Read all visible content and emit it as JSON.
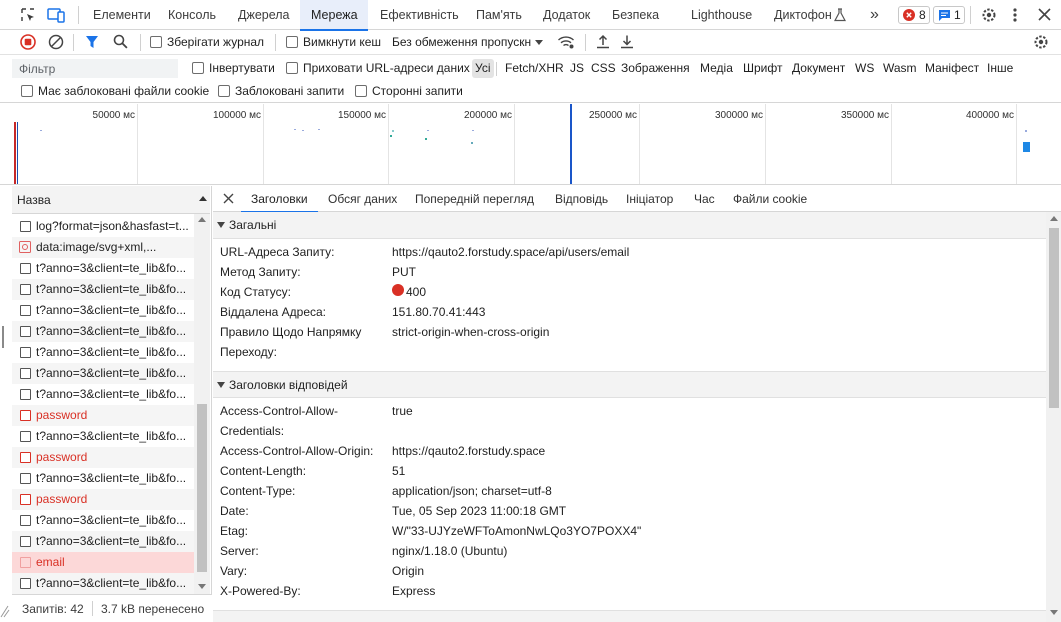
{
  "tabs": {
    "items": [
      "Елементи",
      "Консоль",
      "Джерела",
      "Мережа",
      "Ефективність",
      "Пам'ять",
      "Додаток",
      "Безпека",
      "Lighthouse",
      "Диктофон"
    ],
    "more": "»",
    "errors": "8",
    "messages": "1"
  },
  "toolbar": {
    "preserve_log": "Зберігати журнал",
    "disable_cache": "Вимкнути кеш",
    "throttling": "Без обмеження пропускн"
  },
  "filter": {
    "placeholder": "Фільтр",
    "invert": "Інвертувати",
    "hide_data_urls": "Приховати URL-адреси даних",
    "types": [
      "Усі",
      "Fetch/XHR",
      "JS",
      "CSS",
      "Зображення",
      "Медіа",
      "Шрифт",
      "Документ",
      "WS",
      "Wasm",
      "Маніфест",
      "Інше"
    ],
    "blocked_cookies": "Має заблоковані файли cookie",
    "blocked_requests": "Заблоковані запити",
    "third_party": "Сторонні запити"
  },
  "overview": {
    "ticks": [
      "50000 мс",
      "100000 мс",
      "150000 мс",
      "200000 мс",
      "250000 мс",
      "300000 мс",
      "350000 мс",
      "400000 мс"
    ]
  },
  "requests": {
    "column": "Назва",
    "rows": [
      {
        "name": "log?format=json&hasfast=t...",
        "error": false
      },
      {
        "name": "data:image/svg+xml,...",
        "error": false
      },
      {
        "name": "t?anno=3&client=te_lib&fo...",
        "error": false
      },
      {
        "name": "t?anno=3&client=te_lib&fo...",
        "error": false
      },
      {
        "name": "t?anno=3&client=te_lib&fo...",
        "error": false
      },
      {
        "name": "t?anno=3&client=te_lib&fo...",
        "error": false
      },
      {
        "name": "t?anno=3&client=te_lib&fo...",
        "error": false
      },
      {
        "name": "t?anno=3&client=te_lib&fo...",
        "error": false
      },
      {
        "name": "t?anno=3&client=te_lib&fo...",
        "error": false
      },
      {
        "name": "password",
        "error": true
      },
      {
        "name": "t?anno=3&client=te_lib&fo...",
        "error": false
      },
      {
        "name": "password",
        "error": true
      },
      {
        "name": "t?anno=3&client=te_lib&fo...",
        "error": false
      },
      {
        "name": "password",
        "error": true
      },
      {
        "name": "t?anno=3&client=te_lib&fo...",
        "error": false
      },
      {
        "name": "t?anno=3&client=te_lib&fo...",
        "error": false
      },
      {
        "name": "email",
        "error": true
      },
      {
        "name": "t?anno=3&client=te_lib&fo...",
        "error": false
      }
    ],
    "status_requests": "Запитів: 42",
    "status_transferred": "3.7 kB перенесено"
  },
  "detail": {
    "tabs": [
      "Заголовки",
      "Обсяг даних",
      "Попередній перегляд",
      "Відповідь",
      "Ініціатор",
      "Час",
      "Файли cookie"
    ],
    "general": {
      "title": "Загальні",
      "rows": [
        {
          "key": "URL-Адреса Запиту:",
          "value": "https://qauto2.forstudy.space/api/users/email"
        },
        {
          "key": "Метод Запиту:",
          "value": "PUT"
        },
        {
          "key": "Код Статусу:",
          "value": "400"
        },
        {
          "key": "Віддалена Адреса:",
          "value": "151.80.70.41:443"
        },
        {
          "key": "Правило Щодо Напрямку",
          "value": "strict-origin-when-cross-origin"
        },
        {
          "key": "Переходу:",
          "value": ""
        }
      ]
    },
    "response_headers": {
      "title": "Заголовки відповідей",
      "rows": [
        {
          "key": "Access-Control-Allow-",
          "value": "true"
        },
        {
          "key": "Credentials:",
          "value": ""
        },
        {
          "key": "Access-Control-Allow-Origin:",
          "value": "https://qauto2.forstudy.space"
        },
        {
          "key": "Content-Length:",
          "value": "51"
        },
        {
          "key": "Content-Type:",
          "value": "application/json; charset=utf-8"
        },
        {
          "key": "Date:",
          "value": "Tue, 05 Sep 2023 11:00:18 GMT"
        },
        {
          "key": "Etag:",
          "value": "W/\"33-UJYzeWFToAmonNwLQo3YO7POXX4\""
        },
        {
          "key": "Server:",
          "value": "nginx/1.18.0 (Ubuntu)"
        },
        {
          "key": "Vary:",
          "value": "Origin"
        },
        {
          "key": "X-Powered-By:",
          "value": "Express"
        }
      ]
    },
    "status_dot_color": "#d93025"
  }
}
